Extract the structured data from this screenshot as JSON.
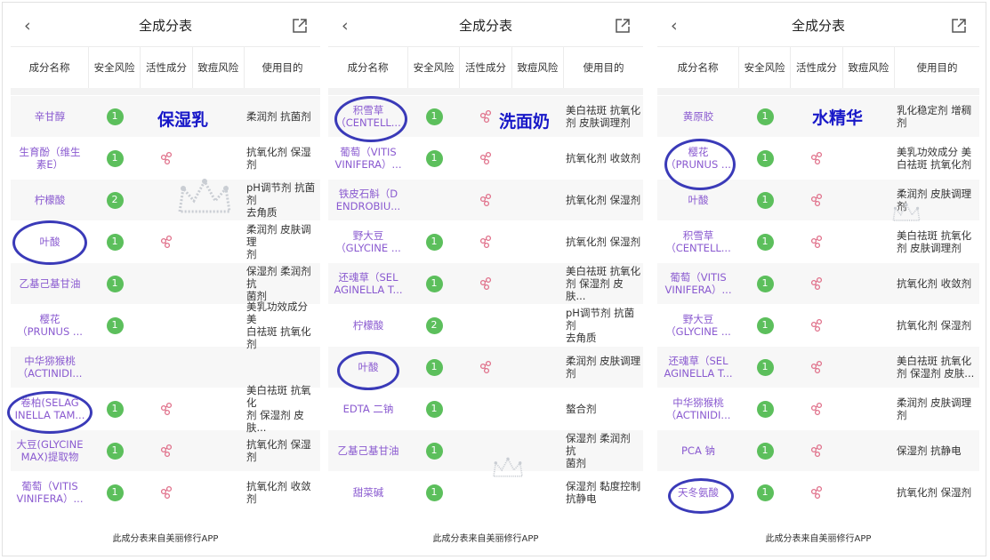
{
  "panels": [
    {
      "title": "全成分表",
      "columns": [
        "成分名称",
        "安全风险",
        "活性成分",
        "致痘风险",
        "使用目的"
      ],
      "rows": [
        {
          "name": "辛甘醇",
          "risk": "1",
          "active": false,
          "purpose": "柔润剂 抗菌剂"
        },
        {
          "name": "生育酚（维生\n素E）",
          "risk": "1",
          "active": true,
          "purpose": "抗氧化剂 保湿剂"
        },
        {
          "name": "柠檬酸",
          "risk": "2",
          "active": false,
          "purpose": "pH调节剂 抗菌剂\n去角质"
        },
        {
          "name": "叶酸",
          "risk": "1",
          "active": true,
          "purpose": "柔润剂 皮肤调理\n剂"
        },
        {
          "name": "乙基己基甘油",
          "risk": "1",
          "active": false,
          "purpose": "保湿剂 柔润剂 抗\n菌剂"
        },
        {
          "name": "樱花\n（PRUNUS ...",
          "risk": "1",
          "active": false,
          "purpose": "美乳功效成分 美\n白祛斑 抗氧化剂"
        },
        {
          "name": "中华猕猴桃\n（ACTINIDI...",
          "risk": "",
          "active": false,
          "purpose": ""
        },
        {
          "name": "卷柏(SELAG\nINELLA TAM...",
          "risk": "1",
          "active": true,
          "purpose": "美白祛斑 抗氧化\n剂 保湿剂 皮肤..."
        },
        {
          "name": "大豆(GLYCINE\nMAX)提取物",
          "risk": "1",
          "active": true,
          "purpose": "抗氧化剂 保湿剂"
        },
        {
          "name": "葡萄（VITIS\nVINIFERA）...",
          "risk": "1",
          "active": true,
          "purpose": "抗氧化剂 收敛剂"
        }
      ],
      "footer": "此成分表来自美丽修行APP",
      "annotation": "保湿乳"
    },
    {
      "title": "全成分表",
      "columns": [
        "成分名称",
        "安全风险",
        "活性成分",
        "致痘风险",
        "使用目的"
      ],
      "rows": [
        {
          "name": "积雪草\n（CENTELL...",
          "risk": "1",
          "active": true,
          "purpose": "美白祛斑 抗氧化\n剂 皮肤调理剂"
        },
        {
          "name": "葡萄（VITIS\nVINIFERA）...",
          "risk": "1",
          "active": true,
          "purpose": "抗氧化剂 收敛剂"
        },
        {
          "name": "铁皮石斛（D\nENDROBIU...",
          "risk": "",
          "active": true,
          "purpose": "抗氧化剂 保湿剂"
        },
        {
          "name": "野大豆\n（GLYCINE ...",
          "risk": "1",
          "active": true,
          "purpose": "抗氧化剂 保湿剂"
        },
        {
          "name": "还魂草（SEL\nAGINELLA T...",
          "risk": "1",
          "active": true,
          "purpose": "美白祛斑 抗氧化\n剂 保湿剂 皮肤..."
        },
        {
          "name": "柠檬酸",
          "risk": "2",
          "active": false,
          "purpose": "pH调节剂 抗菌剂\n去角质"
        },
        {
          "name": "叶酸",
          "risk": "1",
          "active": true,
          "purpose": "柔润剂 皮肤调理\n剂"
        },
        {
          "name": "EDTA 二钠",
          "risk": "1",
          "active": false,
          "purpose": "螯合剂"
        },
        {
          "name": "乙基己基甘油",
          "risk": "1",
          "active": false,
          "purpose": "保湿剂 柔润剂 抗\n菌剂"
        },
        {
          "name": "甜菜碱",
          "risk": "1",
          "active": false,
          "purpose": "保湿剂 黏度控制\n抗静电"
        }
      ],
      "footer": "此成分表来自美丽修行APP",
      "annotation": "洗面奶"
    },
    {
      "title": "全成分表",
      "columns": [
        "成分名称",
        "安全风险",
        "活性成分",
        "致痘风险",
        "使用目的"
      ],
      "rows": [
        {
          "name": "黄原胶",
          "risk": "1",
          "active": false,
          "purpose": "乳化稳定剂 增稠\n剂"
        },
        {
          "name": "樱花\n（PRUNUS ...",
          "risk": "1",
          "active": true,
          "purpose": "美乳功效成分 美\n白祛斑 抗氧化剂"
        },
        {
          "name": "叶酸",
          "risk": "1",
          "active": true,
          "purpose": "柔润剂 皮肤调理\n剂"
        },
        {
          "name": "积雪草\n（CENTELL...",
          "risk": "1",
          "active": true,
          "purpose": "美白祛斑 抗氧化\n剂 皮肤调理剂"
        },
        {
          "name": "葡萄（VITIS\nVINIFERA）...",
          "risk": "1",
          "active": true,
          "purpose": "抗氧化剂 收敛剂"
        },
        {
          "name": "野大豆\n（GLYCINE ...",
          "risk": "1",
          "active": true,
          "purpose": "抗氧化剂 保湿剂"
        },
        {
          "name": "还魂草（SEL\nAGINELLA T...",
          "risk": "1",
          "active": true,
          "purpose": "美白祛斑 抗氧化\n剂 保湿剂 皮肤..."
        },
        {
          "name": "中华猕猴桃\n（ACTINIDI...",
          "risk": "1",
          "active": true,
          "purpose": "柔润剂 皮肤调理\n剂"
        },
        {
          "name": "PCA 钠",
          "risk": "1",
          "active": true,
          "purpose": "保湿剂 抗静电"
        },
        {
          "name": "天冬氨酸",
          "risk": "1",
          "active": true,
          "purpose": "抗氧化剂 保湿剂"
        }
      ],
      "footer": "此成分表来自美丽修行APP",
      "annotation": "水精华"
    }
  ],
  "colors": {
    "name_text": "#8a5ad0",
    "risk_green": "#5cbf5c",
    "active_pink": "#e0708a",
    "annotation_blue": "#1818c8",
    "circle_blue": "#3a3ab8"
  },
  "icons": {
    "back": "chevron-left-icon",
    "share": "share-external-icon",
    "active": "molecule-icon",
    "crown": "crown-watermark"
  }
}
